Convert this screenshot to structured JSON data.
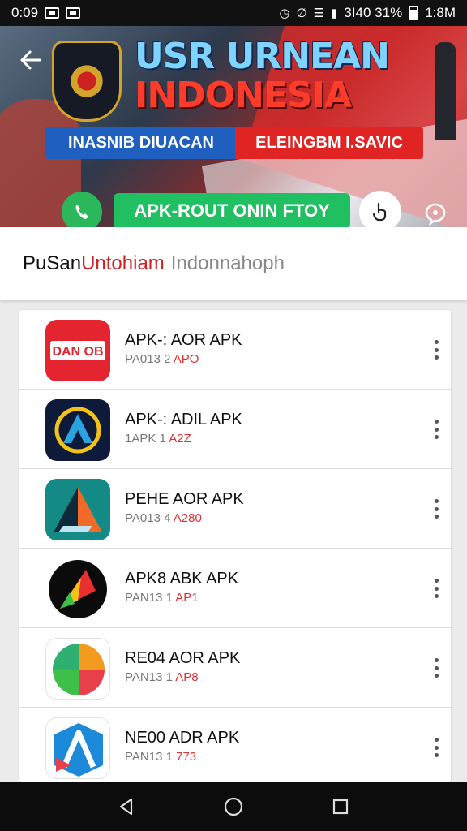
{
  "status_bar": {
    "time_left": "0:09",
    "right_text": "3I40 31%",
    "time_right": "1:8M"
  },
  "banner": {
    "title": "USR URNEAN",
    "subtitle": "INDONESIA",
    "ribbon_left": "INASNIB DIUACAN",
    "ribbon_right": "ELEINGBM I.SAVIC",
    "apk_button": "APK-ROUT ONIN FTOY",
    "icons": [
      "back-arrow",
      "emblem",
      "phone",
      "hand-pointer",
      "chat"
    ],
    "carousel": {
      "count": 3,
      "active": 0
    }
  },
  "header": {
    "part1": "PuSan",
    "part2": "Untohiam",
    "part3": "Indonnahoph"
  },
  "apps": [
    {
      "name": "APK-: AOR APK",
      "meta_a": "PA013 2",
      "meta_b": "APO",
      "icon": "dan-ob-logo"
    },
    {
      "name": "APK-: ADIL APK",
      "meta_a": "1APK 1",
      "meta_b": "A2Z",
      "icon": "a-triangle-blue-logo"
    },
    {
      "name": "PEHE AOR APK",
      "meta_a": "PA013 4",
      "meta_b": "A280",
      "icon": "a-teal-logo"
    },
    {
      "name": "APK8 ABK APK",
      "meta_a": "PAN13 1",
      "meta_b": "AP1",
      "icon": "black-circle-logo"
    },
    {
      "name": "RE04 AOR APK",
      "meta_a": "PAN13 1",
      "meta_b": "AP8",
      "icon": "colorful-pie-logo"
    },
    {
      "name": "NE00 ADR APK",
      "meta_a": "PAN13 1",
      "meta_b": "773",
      "icon": "blue-a-logo"
    }
  ],
  "colors": {
    "accent_green": "#1fbf62",
    "accent_red": "#e02424",
    "accent_blue": "#1f5fbf",
    "header_red": "#d32020"
  },
  "nav": [
    "back-icon",
    "home-icon",
    "recents-icon"
  ]
}
